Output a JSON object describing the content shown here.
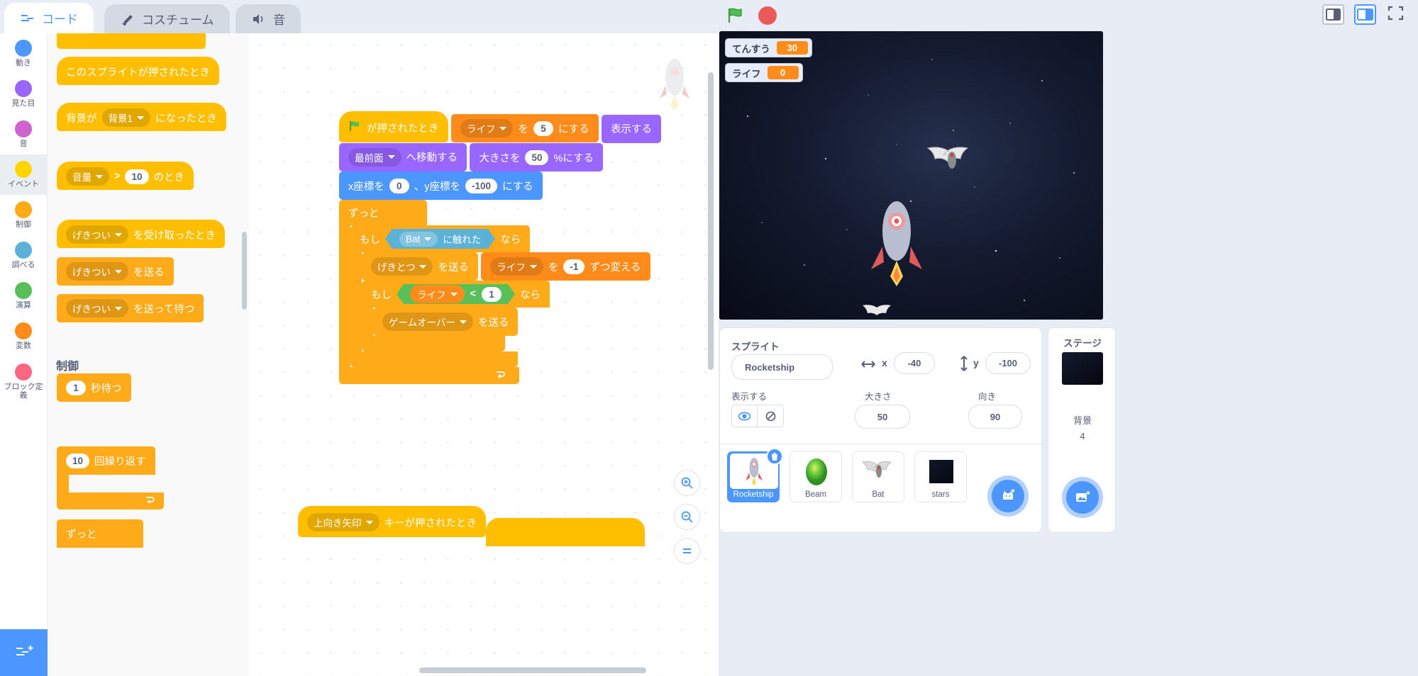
{
  "tabs": [
    {
      "label": "コード",
      "icon": "code-icon",
      "active": true
    },
    {
      "label": "コスチューム",
      "icon": "costume-brush-icon",
      "active": false
    },
    {
      "label": "音",
      "icon": "sound-speaker-icon",
      "active": false
    }
  ],
  "categories": [
    {
      "label": "動き",
      "color": "#4c97ff",
      "selected": false
    },
    {
      "label": "見た目",
      "color": "#9966ff",
      "selected": false
    },
    {
      "label": "音",
      "color": "#cf63cf",
      "selected": false
    },
    {
      "label": "イベント",
      "color": "#ffd500",
      "selected": true
    },
    {
      "label": "制御",
      "color": "#ffab19",
      "selected": false
    },
    {
      "label": "調べる",
      "color": "#5cb1d6",
      "selected": false
    },
    {
      "label": "演算",
      "color": "#59c059",
      "selected": false
    },
    {
      "label": "変数",
      "color": "#ff8c1a",
      "selected": false
    },
    {
      "label": "ブロック定義",
      "color": "#ff6680",
      "selected": false
    }
  ],
  "add_extension_label": "拡張機能を追加",
  "palette": {
    "blocks": [
      {
        "text_before": "このスプライトが押されたとき",
        "kind": "hat"
      },
      {
        "text_before": "背景が",
        "dropdown": "背景1",
        "text_after": "になったとき",
        "kind": "hat"
      },
      {
        "text_before": "音量",
        "dropdown_lead": true,
        "op": ">",
        "num": "10",
        "text_after": "のとき",
        "kind": "hat"
      },
      {
        "text_before": "",
        "dropdown": "げきつい",
        "text_after": "を受け取ったとき",
        "kind": "hat"
      },
      {
        "text_before": "",
        "dropdown": "げきつい",
        "text_after": "を送る",
        "kind": "stack"
      },
      {
        "text_before": "",
        "dropdown": "げきつい",
        "text_after": "を送って待つ",
        "kind": "stack"
      }
    ],
    "section_header": "制御",
    "control_blocks": [
      {
        "num": "1",
        "text_after": "秒待つ"
      },
      {
        "num": "10",
        "text_after": "回繰り返す"
      },
      {
        "text_before": "ずっと"
      }
    ]
  },
  "script": {
    "hat": {
      "icon": "green-flag-icon",
      "text": "が押されたとき"
    },
    "lines": [
      {
        "id": "set-life",
        "type": "var",
        "parts": [
          {
            "t": "drop",
            "v": "ライフ"
          },
          {
            "t": "txt",
            "v": "を"
          },
          {
            "t": "num",
            "v": "5"
          },
          {
            "t": "txt",
            "v": "にする"
          }
        ]
      },
      {
        "id": "show",
        "type": "look",
        "parts": [
          {
            "t": "txt",
            "v": "表示する"
          }
        ]
      },
      {
        "id": "goto-layer",
        "type": "look",
        "parts": [
          {
            "t": "drop",
            "v": "最前面"
          },
          {
            "t": "txt",
            "v": "へ移動する"
          }
        ]
      },
      {
        "id": "set-size",
        "type": "look",
        "parts": [
          {
            "t": "txt",
            "v": "大きさを"
          },
          {
            "t": "num",
            "v": "50"
          },
          {
            "t": "txt",
            "v": "%にする"
          }
        ]
      },
      {
        "id": "goto-xy",
        "type": "mot",
        "parts": [
          {
            "t": "txt",
            "v": "x座標を"
          },
          {
            "t": "num",
            "v": "0"
          },
          {
            "t": "txt",
            "v": "、y座標を"
          },
          {
            "t": "num",
            "v": "-100"
          },
          {
            "t": "txt",
            "v": "にする"
          }
        ]
      }
    ],
    "forever_label": "ずっと",
    "if1": {
      "label": "もし",
      "sensor": "Bat",
      "sensor_suffix": "に触れた",
      "then": "なら"
    },
    "if1_body": [
      {
        "id": "broadcast-hit",
        "type": "ev2",
        "parts": [
          {
            "t": "drop",
            "v": "げきとつ"
          },
          {
            "t": "txt",
            "v": "を送る"
          }
        ]
      },
      {
        "id": "change-life",
        "type": "var",
        "parts": [
          {
            "t": "drop",
            "v": "ライフ"
          },
          {
            "t": "txt",
            "v": "を"
          },
          {
            "t": "num",
            "v": "-1"
          },
          {
            "t": "txt",
            "v": "ずつ変える"
          }
        ]
      }
    ],
    "if2": {
      "label": "もし",
      "var": "ライフ",
      "op": "<",
      "num": "1",
      "then": "なら"
    },
    "if2_body": [
      {
        "id": "broadcast-gameover",
        "type": "ev2",
        "parts": [
          {
            "t": "drop",
            "v": "ゲームオーバー"
          },
          {
            "t": "txt",
            "v": "を送る"
          }
        ]
      }
    ],
    "bottom_hat": {
      "dropdown": "上向き矢印",
      "text": "キーが押されたとき"
    }
  },
  "canvas": {
    "zoom_in": "+",
    "zoom_out": "−",
    "zoom_reset": "="
  },
  "stage": {
    "monitors": [
      {
        "name": "てんすう",
        "value": "30"
      },
      {
        "name": "ライフ",
        "value": "0"
      }
    ]
  },
  "sprite_panel": {
    "title": "スプライト",
    "name_value": "Rocketship",
    "x_label": "x",
    "x_value": "-40",
    "y_label": "y",
    "y_value": "-100",
    "show_label": "表示する",
    "size_label": "大きさ",
    "size_value": "50",
    "direction_label": "向き",
    "direction_value": "90"
  },
  "sprites": [
    {
      "name": "Rocketship",
      "selected": true,
      "icon": "rocket-icon"
    },
    {
      "name": "Beam",
      "selected": false,
      "icon": "beam-icon"
    },
    {
      "name": "Bat",
      "selected": false,
      "icon": "bat-icon"
    },
    {
      "name": "stars",
      "selected": false,
      "icon": "stars-icon"
    }
  ],
  "stage_pane": {
    "title": "ステージ",
    "backdrop_label": "背景",
    "backdrop_count": "4"
  },
  "colors": {
    "accent": "#4c97ff",
    "event": "#ffbf00",
    "control": "#ffab19",
    "looks": "#9966ff",
    "motion": "#4c97ff",
    "variables": "#ff8c1a",
    "sensing": "#5cb1d6",
    "operators": "#59c059",
    "stop_red": "#ec5959"
  }
}
